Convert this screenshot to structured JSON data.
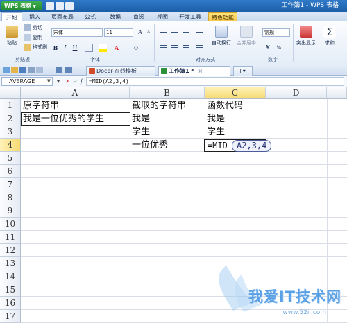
{
  "app": {
    "menu_label": "WPS 表格",
    "window_title": "工作簿1 - WPS 表格"
  },
  "ribbon_tabs": [
    "开始",
    "插入",
    "页面布局",
    "公式",
    "数据",
    "审阅",
    "视图",
    "开发工具",
    "特色功能"
  ],
  "ribbon": {
    "clipboard": {
      "paste": "粘贴",
      "cut": "剪切",
      "copy": "复制",
      "format_painter": "格式刷",
      "group": "剪贴板"
    },
    "font": {
      "name": "宋体",
      "size": "11",
      "group": "字体"
    },
    "alignment": {
      "wrap": "自动换行",
      "merge": "合并居中",
      "group": "对齐方式"
    },
    "number": {
      "format": "常规",
      "group": "数字"
    },
    "extra": {
      "show": "突出显示",
      "sum": "求和"
    }
  },
  "doc_tabs": [
    {
      "label": "Docer-在线模板",
      "active": false
    },
    {
      "label": "工作簿1 *",
      "active": true
    }
  ],
  "formula_bar": {
    "name_box": "AVERAGE",
    "formula": "=MID(A2,3,4)"
  },
  "grid": {
    "columns": [
      "A",
      "B",
      "C",
      "D"
    ],
    "rows": [
      "1",
      "2",
      "3",
      "4",
      "5",
      "6",
      "7",
      "8",
      "9",
      "10",
      "11",
      "12",
      "13",
      "14",
      "15",
      "16",
      "17"
    ],
    "cells": {
      "A1": "原字符串",
      "A2": "我是一位优秀的学生",
      "B1": "截取的字符串",
      "B2": "我是",
      "B3": "学生",
      "B4": "一位优秀",
      "C1": "函数代码",
      "C2": "我是",
      "C3": "学生",
      "C4_prefix": "=MID",
      "C4_args": "A2,3,4"
    }
  },
  "watermark": {
    "text": "我爱IT技术网",
    "url": "www.52ij.com"
  },
  "colors": {
    "titlebar": "#1c5fa8",
    "selection_header": "#f6d972",
    "accent": "#3fb04a"
  }
}
